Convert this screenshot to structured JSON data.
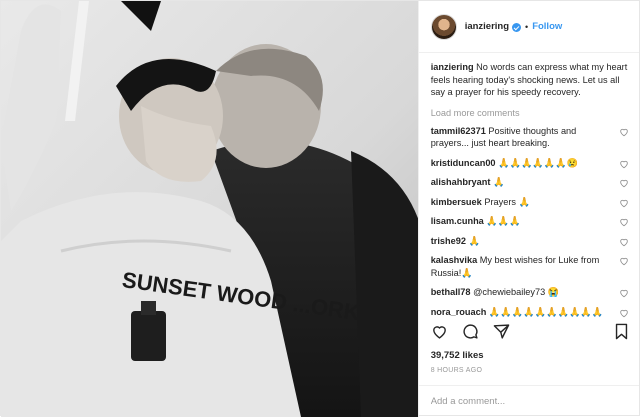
{
  "post": {
    "username": "ianziering",
    "follow_label": "Follow",
    "separator": "•",
    "caption": "No words can express what my heart feels hearing today's shocking news. Let us all say a prayer for his speedy recovery.",
    "load_more": "Load more comments",
    "likes": "39,752 likes",
    "timestamp": "8 HOURS AGO",
    "add_comment_placeholder": "Add a comment...",
    "photo_shirt_text": "SUNSET  WOOD  ...ORK"
  },
  "comments": [
    {
      "user": "tammil62371",
      "text": "Positive thoughts and prayers... just heart breaking."
    },
    {
      "user": "kristiduncan00",
      "text": "🙏🙏🙏🙏🙏🙏😢"
    },
    {
      "user": "alishahbryant",
      "text": "🙏"
    },
    {
      "user": "kimbersuek",
      "text": "Prayers 🙏"
    },
    {
      "user": "lisam.cunha",
      "text": "🙏🙏🙏"
    },
    {
      "user": "trishe92",
      "text": "🙏"
    },
    {
      "user": "kalashvika",
      "text": "My best wishes for Luke from Russia!🙏"
    },
    {
      "user": "bethall78",
      "text": "@chewiebailey73 😭"
    },
    {
      "user": "nora_rouach",
      "text": "🙏🙏🙏🙏🙏🙏🙏🙏🙏🙏"
    }
  ],
  "icons": [
    "heart-icon",
    "comment-icon",
    "share-icon",
    "bookmark-icon",
    "verified-icon"
  ],
  "colors": {
    "link": "#3897f0",
    "muted": "#999999",
    "text": "#262626"
  }
}
